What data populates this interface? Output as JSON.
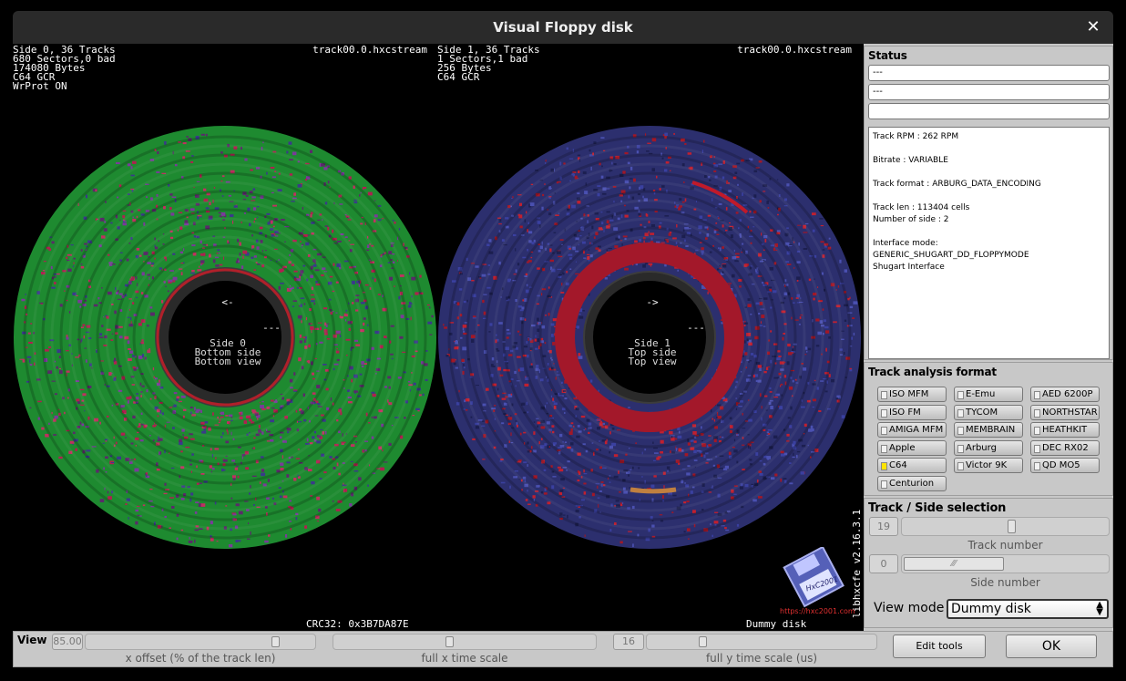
{
  "window": {
    "title": "Visual Floppy disk",
    "close_glyph": "✕"
  },
  "side0": {
    "info_lines": [
      "Side 0, 36 Tracks",
      "680 Sectors,0 bad",
      "174080 Bytes",
      "C64 GCR",
      "WrProt ON"
    ],
    "file": "track00.0.hxcstream",
    "arrow": "<-",
    "dashes": "---",
    "center_label": [
      "Side 0",
      "Bottom side",
      "Bottom view"
    ],
    "color": "#1e8a30"
  },
  "side1": {
    "info_lines": [
      "Side 1, 36 Tracks",
      "1 Sectors,1 bad",
      "256 Bytes",
      "C64 GCR"
    ],
    "file": "track00.0.hxcstream",
    "arrow": "->",
    "dashes": "---",
    "center_label": [
      "Side 1",
      "Top side",
      "Top view"
    ],
    "color": "#2c2f6e"
  },
  "crc": "CRC32: 0x3B7DA87E",
  "dummy_label": "Dummy disk",
  "version": "libhxcfe v2.16.3.1",
  "logo_url": "https://hxc2001.com",
  "logo_text": "HxC2001",
  "status": {
    "title": "Status",
    "fields": [
      "---",
      "---",
      ""
    ],
    "info": "Track RPM : 262 RPM\n\nBitrate : VARIABLE\n\nTrack format : ARBURG_DATA_ENCODING\n\nTrack len : 113404 cells\nNumber of side : 2\n\nInterface mode:\nGENERIC_SHUGART_DD_FLOPPYMODE\nShugart Interface"
  },
  "analysis": {
    "title": "Track analysis format",
    "formats": [
      "ISO MFM",
      "E-Emu",
      "AED 6200P",
      "ISO FM",
      "TYCOM",
      "NORTHSTAR",
      "AMIGA MFM",
      "MEMBRAIN",
      "HEATHKIT",
      "Apple",
      "Arburg",
      "DEC RX02",
      "C64",
      "Victor 9K",
      "QD MO5",
      "Centurion"
    ],
    "active": "C64",
    "active_color": "#ffe400"
  },
  "selection": {
    "title": "Track / Side selection",
    "track_value": "19",
    "track_caption": "Track number",
    "track_fraction": 0.53,
    "side_value": "0",
    "side_caption": "Side number",
    "view_mode_label": "View mode",
    "view_mode_value": "Dummy disk"
  },
  "view": {
    "title": "View",
    "x_offset_value": "85.00",
    "x_offset_caption": "x offset (% of the track len)",
    "x_offset_fraction": 0.84,
    "x_time_caption": "full x time scale",
    "x_time_fraction": 0.44,
    "y_time_value": "16",
    "y_time_caption": "full y time scale (us)",
    "y_time_fraction": 0.23,
    "edit_tools": "Edit tools",
    "ok": "OK"
  }
}
